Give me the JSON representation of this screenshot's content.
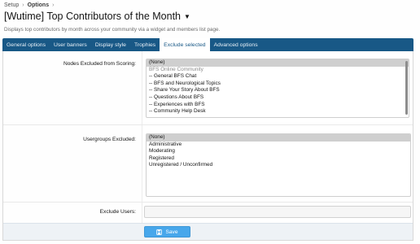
{
  "breadcrumb": {
    "items": [
      "Setup",
      "Options"
    ],
    "separator": "›"
  },
  "page": {
    "title": "[Wutime] Top Contributors of the Month",
    "description": "Displays top contributors by month across your community via a widget and members list page."
  },
  "tabs": [
    {
      "label": "General options",
      "active": false
    },
    {
      "label": "User banners",
      "active": false
    },
    {
      "label": "Display style",
      "active": false
    },
    {
      "label": "Trophies",
      "active": false
    },
    {
      "label": "Exclude selected",
      "active": true
    },
    {
      "label": "Advanced options",
      "active": false
    }
  ],
  "form": {
    "nodes_label": "Nodes Excluded from Scoring:",
    "nodes_options": [
      {
        "label": "(None)",
        "selected": true,
        "muted": false
      },
      {
        "label": "BFS Online Community",
        "selected": false,
        "muted": true
      },
      {
        "label": "-- General BFS Chat",
        "selected": false,
        "muted": false
      },
      {
        "label": "-- BFS and Neurological Topics",
        "selected": false,
        "muted": false
      },
      {
        "label": "-- Share Your Story About BFS",
        "selected": false,
        "muted": false
      },
      {
        "label": "-- Questions About BFS",
        "selected": false,
        "muted": false
      },
      {
        "label": "-- Experiences with BFS",
        "selected": false,
        "muted": false
      },
      {
        "label": "-- Community Help Desk",
        "selected": false,
        "muted": false
      }
    ],
    "usergroups_label": "Usergroups Excluded:",
    "usergroups_options": [
      {
        "label": "(None)",
        "selected": true
      },
      {
        "label": "Administrative",
        "selected": false
      },
      {
        "label": "Moderating",
        "selected": false
      },
      {
        "label": "Registered",
        "selected": false
      },
      {
        "label": "Unregistered / Unconfirmed",
        "selected": false
      }
    ],
    "users_label": "Exclude Users:",
    "users_value": ""
  },
  "footer": {
    "save_label": "Save"
  },
  "colors": {
    "tab_bar": "#185886",
    "save_button": "#47a7eb",
    "selected_option": "#cfcfcf"
  }
}
